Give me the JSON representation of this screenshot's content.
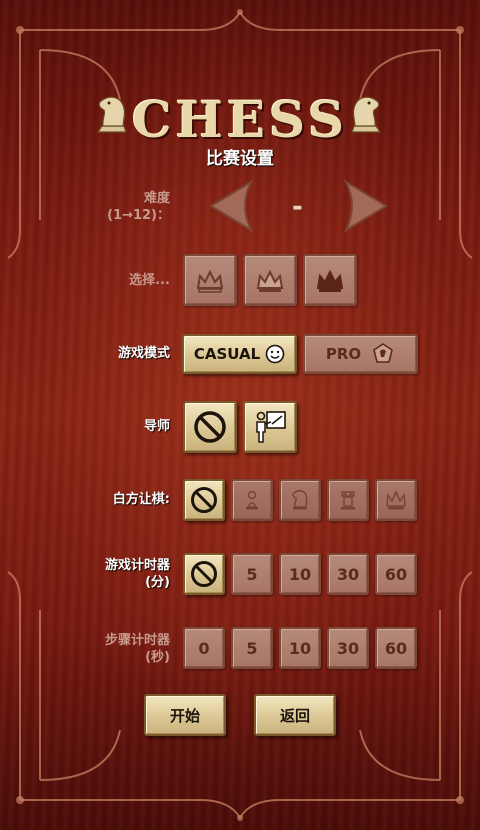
{
  "header": {
    "logo_text": "CHESS",
    "subtitle": "比赛设置"
  },
  "difficulty": {
    "label_line1": "难度",
    "label_line2": "(1→12)：",
    "value": "-"
  },
  "select": {
    "label": "选择..."
  },
  "game_mode": {
    "label": "游戏模式",
    "casual": "CASUAL",
    "pro": "PRO"
  },
  "tutor": {
    "label": "导师"
  },
  "handicap": {
    "label": "白方让棋:"
  },
  "game_timer": {
    "label_line1": "游戏计时器",
    "label_line2": "(分)",
    "options": [
      "5",
      "10",
      "30",
      "60"
    ]
  },
  "move_timer": {
    "label_line1": "步骤计时器",
    "label_line2": "(秒)",
    "options": [
      "0",
      "5",
      "10",
      "30",
      "60"
    ]
  },
  "footer": {
    "start": "开始",
    "back": "返回"
  },
  "colors": {
    "wood_dark": "#5a0f0a",
    "wood_mid": "#8a2414",
    "button_light": "#e8d9ae",
    "button_dim": "#a97767"
  }
}
